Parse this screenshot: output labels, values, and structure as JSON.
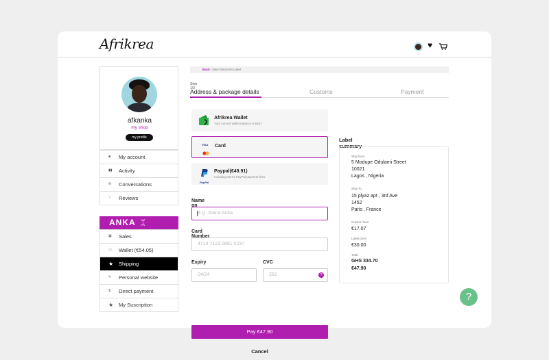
{
  "header": {
    "logo": "Afrikrea"
  },
  "profile": {
    "name": "afkanka",
    "shop_link": "my shop",
    "profile_button": "my profile"
  },
  "menu": {
    "items": [
      {
        "label": "My account",
        "icon": "home-icon"
      },
      {
        "label": "Activity",
        "icon": "bar-chart-icon"
      },
      {
        "label": "Conversations",
        "icon": "mail-icon"
      },
      {
        "label": "Reviews",
        "icon": "star-outline-icon"
      }
    ]
  },
  "anka": {
    "brand": "ANKA",
    "glyph": "ᛯ",
    "items": [
      {
        "label": "Sales",
        "icon": "sales-icon"
      },
      {
        "label": "Wallet (€54.05)",
        "icon": "wallet-icon"
      },
      {
        "label": "Shipping",
        "icon": "star-icon",
        "active": true
      },
      {
        "label": "Personal website",
        "icon": "pencil-icon"
      },
      {
        "label": "Direct  payment",
        "icon": "dollar-icon"
      },
      {
        "label": "My Suscription",
        "icon": "star-icon"
      }
    ]
  },
  "breadcrumb": {
    "back": "Back",
    "rest": " / New Shipment Label"
  },
  "steps": {
    "step_label": "Step 1/3",
    "tabs": [
      "Address & package details",
      "Customs",
      "Payment"
    ]
  },
  "payment_methods": [
    {
      "title": "Afrikrea Wallet",
      "subtitle": "Your current wallet balance is €527"
    },
    {
      "title": "Card",
      "subtitle": "",
      "badge": "VISA"
    },
    {
      "title": "Paypal(€49.91)",
      "subtitle": "Including €2.01 PayPal payment fees.",
      "badge": "PayPal"
    }
  ],
  "form": {
    "name_label": "Name on card",
    "name_placeholder": "E.g. Joana Anka",
    "number_label": "Card Number",
    "number_placeholder": "4714  7123  0861 0237",
    "expiry_label": "Expiry",
    "expiry_placeholder": "04/24",
    "cvc_label": "CVC",
    "cvc_placeholder": "262",
    "pay_button": "Pay €47.90",
    "cancel": "Cancel"
  },
  "summary": {
    "title": "Label summary",
    "ship_from_label": "Ship from",
    "ship_from": [
      "5 Modupe Odulami Street",
      "10021",
      "Lagos , Nigeria"
    ],
    "ship_to_label": "Ship To",
    "ship_to": [
      "15 plyaz apt , 3rd Ave",
      "1452",
      "Paris , France"
    ],
    "custom_fees_label": "Custom fees",
    "custom_fees": "€17.07",
    "label_price_label": "Label price",
    "label_price": "€30.00",
    "total_label": "Total",
    "total_ghs": "GHS 334.70",
    "total_eur": "€47.90"
  },
  "colors": {
    "accent": "#b01eaf",
    "help": "#6ac28b"
  }
}
